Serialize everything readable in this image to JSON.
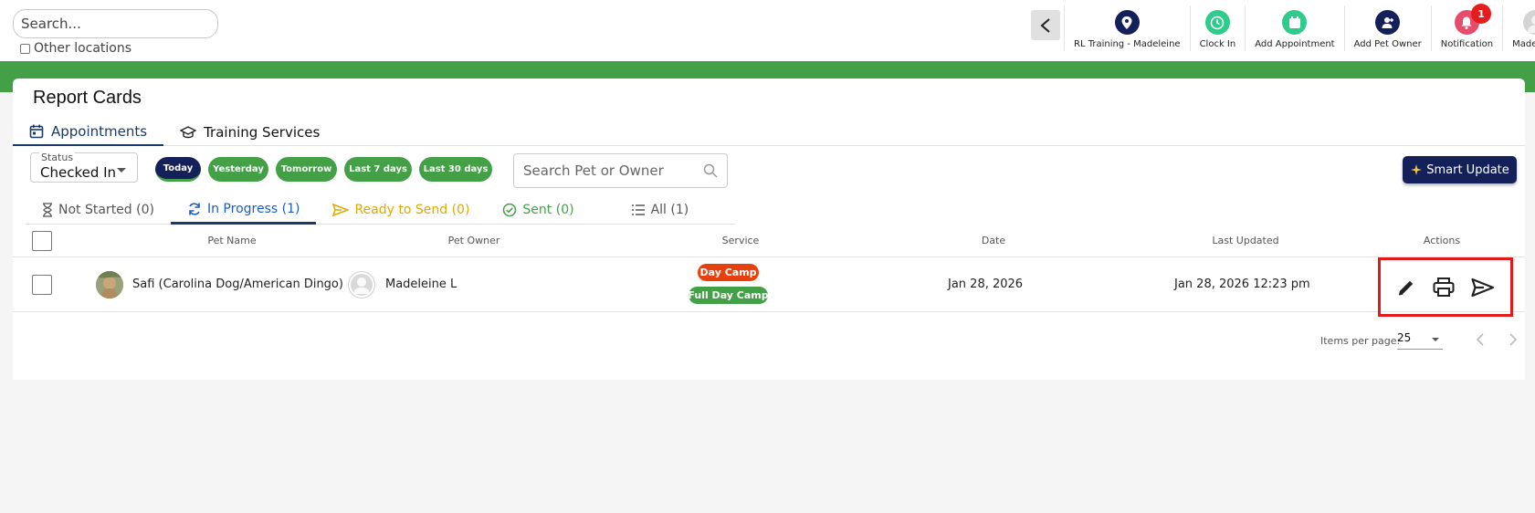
{
  "topbar": {
    "search_placeholder": "Search...",
    "other_locations_label": "Other locations",
    "nav": [
      {
        "label": "RL Training - Madeleine",
        "icon": "location-pin-icon",
        "color": "#13205a"
      },
      {
        "label": "Clock In",
        "icon": "clock-icon",
        "color": "#2ecc8a"
      },
      {
        "label": "Add Appointment",
        "icon": "calendar-add-icon",
        "color": "#2ecc8a"
      },
      {
        "label": "Add Pet Owner",
        "icon": "user-add-icon",
        "color": "#13205a"
      },
      {
        "label": "Notification",
        "icon": "bell-icon",
        "color": "#e74c6a",
        "badge": "1"
      },
      {
        "label": "Madeleine",
        "icon": "user-avatar-icon",
        "color": "#cfcfcf"
      }
    ]
  },
  "page": {
    "title": "Report Cards",
    "tabs": [
      {
        "label": "Appointments",
        "icon": "calendar-icon",
        "active": true
      },
      {
        "label": "Training Services",
        "icon": "graduation-cap-icon",
        "active": false
      }
    ]
  },
  "filters": {
    "status_legend": "Status",
    "status_value": "Checked In",
    "date_chips": [
      {
        "label": "Today",
        "active": true
      },
      {
        "label": "Yesterday",
        "active": false
      },
      {
        "label": "Tomorrow",
        "active": false
      },
      {
        "label": "Last 7 days",
        "active": false
      },
      {
        "label": "Last 30 days",
        "active": false
      }
    ],
    "search_placeholder": "Search Pet or Owner",
    "smart_update_label": "Smart Update"
  },
  "status_tabs": [
    {
      "label": "Not Started (0)",
      "icon": "hourglass-icon",
      "color": "#555555"
    },
    {
      "label": "In Progress (1)",
      "icon": "refresh-icon",
      "color": "#1a5dc1",
      "active": true
    },
    {
      "label": "Ready to Send (0)",
      "icon": "send-icon",
      "color": "#e0a800"
    },
    {
      "label": "Sent (0)",
      "icon": "check-circle-icon",
      "color": "#43a047"
    },
    {
      "label": "All (1)",
      "icon": "list-icon",
      "color": "#555555"
    }
  ],
  "table": {
    "headers": {
      "pet_name": "Pet Name",
      "pet_owner": "Pet Owner",
      "service": "Service",
      "date": "Date",
      "last_updated": "Last Updated",
      "actions": "Actions"
    },
    "rows": [
      {
        "pet_name": "Safi (Carolina Dog/American Dingo)",
        "owner": "Madeleine L",
        "services": [
          {
            "label": "Day Camp",
            "color": "#e8400c"
          },
          {
            "label": "Full Day Camp",
            "color": "#43a047"
          }
        ],
        "date": "Jan 28, 2026",
        "last_updated": "Jan 28, 2026 12:23 pm"
      }
    ]
  },
  "pagination": {
    "items_per_page_label": "Items per page:",
    "items_per_page_value": "25"
  }
}
